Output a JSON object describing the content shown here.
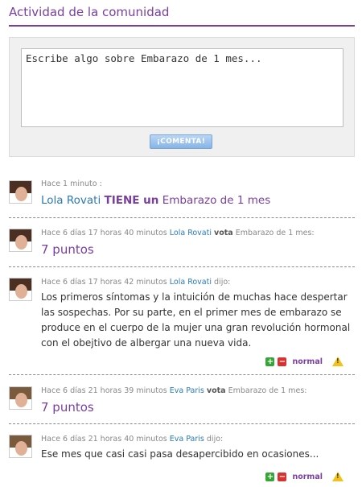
{
  "header": {
    "title": "Actividad de la comunidad"
  },
  "composer": {
    "placeholder": "Escribe algo sobre Embarazo de 1 mes...",
    "button_label": "¡COMENTA!"
  },
  "entries": [
    {
      "time": "Hace 1 minuto :",
      "user": "Lola Rovati",
      "verb": "TIENE un",
      "object": "Embarazo de 1 mes"
    },
    {
      "time": "Hace 6 días 17 horas 40 minutos",
      "user": "Lola Rovati",
      "action": "vota",
      "object": "Embarazo de 1 mes:",
      "score": "7 puntos"
    },
    {
      "time": "Hace 6 días 17 horas 42 minutos",
      "user": "Lola Rovati",
      "action": "dijo:",
      "comment": "Los primeros síntomas y la intuición de muchas hace despertar las sospechas. Por su parte, en el primer mes de embarazo se produce en el cuerpo de la mujer una gran revolución hormonal con el obejtivo de albergar una nueva vida.",
      "rating_label": "normal"
    },
    {
      "time": "Hace 6 días 21 horas 39 minutos",
      "user": "Eva Paris",
      "action": "vota",
      "object": "Embarazo de 1 mes:",
      "score": "7 puntos"
    },
    {
      "time": "Hace 6 días 21 horas 40 minutos",
      "user": "Eva Paris",
      "action": "dijo:",
      "comment": "Ese mes que casi casi pasa desapercibido en ocasiones...",
      "rating_label": "normal"
    }
  ],
  "icons": {
    "vote_up": "plus-icon",
    "vote_down": "minus-icon",
    "report": "warning-icon"
  },
  "colors": {
    "accent": "#7a3ea0",
    "link": "#2a7ab8",
    "vote_up": "#35a535",
    "vote_down": "#d93030",
    "warning": "#f3c21a"
  }
}
